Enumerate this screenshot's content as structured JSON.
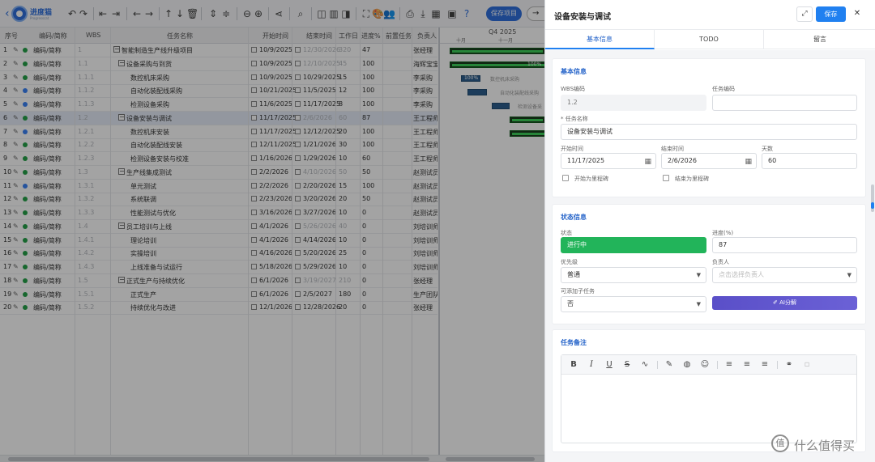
{
  "toolbar": {
    "logo_text": "进度猫",
    "logo_sub": "Progresscat",
    "save_project_label": "保存项目"
  },
  "grid": {
    "columns": [
      "序号",
      "编码/简称",
      "WBS",
      "任务名称",
      "开始时间",
      "结束时间",
      "工作日",
      "进度%",
      "前置任务",
      "负责人"
    ],
    "rows": [
      {
        "no": "1",
        "code": "编码/简称",
        "wbs": "1",
        "name": "智能制造生产线升级项目",
        "start": "10/9/2025",
        "end": "12/30/2026",
        "days": "320",
        "pct": "47",
        "owner": "张经理",
        "level": 0,
        "group": true
      },
      {
        "no": "2",
        "code": "编码/简称",
        "wbs": "1.1",
        "name": "设备采购与到货",
        "start": "10/9/2025",
        "end": "12/10/2025",
        "days": "45",
        "pct": "100",
        "owner": "海辉宝宝",
        "level": 1,
        "group": true
      },
      {
        "no": "3",
        "code": "编码/简称",
        "wbs": "1.1.1",
        "name": "数控机床采购",
        "start": "10/9/2025",
        "end": "10/29/2025",
        "days": "15",
        "pct": "100",
        "owner": "李采购",
        "level": 2,
        "group": false
      },
      {
        "no": "4",
        "code": "编码/简称",
        "wbs": "1.1.2",
        "name": "自动化装配线采购",
        "start": "10/21/2025",
        "end": "11/5/2025",
        "days": "12",
        "pct": "100",
        "owner": "李采购",
        "level": 2,
        "group": false
      },
      {
        "no": "5",
        "code": "编码/简称",
        "wbs": "1.1.3",
        "name": "检测设备采购",
        "start": "11/6/2025",
        "end": "11/17/2025",
        "days": "8",
        "pct": "100",
        "owner": "李采购",
        "level": 2,
        "group": false
      },
      {
        "no": "6",
        "code": "编码/简称",
        "wbs": "1.2",
        "name": "设备安装与调试",
        "start": "11/17/2025",
        "end": "2/6/2026",
        "days": "60",
        "pct": "87",
        "owner": "王工程师",
        "level": 1,
        "group": true
      },
      {
        "no": "7",
        "code": "编码/简称",
        "wbs": "1.2.1",
        "name": "数控机床安装",
        "start": "11/17/2025",
        "end": "12/12/2025",
        "days": "20",
        "pct": "100",
        "owner": "王工程师",
        "level": 2,
        "group": false
      },
      {
        "no": "8",
        "code": "编码/简称",
        "wbs": "1.2.2",
        "name": "自动化装配线安装",
        "start": "12/11/2025",
        "end": "1/21/2026",
        "days": "30",
        "pct": "100",
        "owner": "王工程师",
        "level": 2,
        "group": false
      },
      {
        "no": "9",
        "code": "编码/简称",
        "wbs": "1.2.3",
        "name": "检测设备安装与校准",
        "start": "1/16/2026",
        "end": "1/29/2026",
        "days": "10",
        "pct": "60",
        "owner": "王工程师",
        "level": 2,
        "group": false
      },
      {
        "no": "10",
        "code": "编码/简称",
        "wbs": "1.3",
        "name": "生产线集成测试",
        "start": "2/2/2026",
        "end": "4/10/2026",
        "days": "50",
        "pct": "50",
        "owner": "赵测试员",
        "level": 1,
        "group": true
      },
      {
        "no": "11",
        "code": "编码/简称",
        "wbs": "1.3.1",
        "name": "单元测试",
        "start": "2/2/2026",
        "end": "2/20/2026",
        "days": "15",
        "pct": "100",
        "owner": "赵测试员",
        "level": 2,
        "group": false
      },
      {
        "no": "12",
        "code": "编码/简称",
        "wbs": "1.3.2",
        "name": "系统联调",
        "start": "2/23/2026",
        "end": "3/20/2026",
        "days": "20",
        "pct": "50",
        "owner": "赵测试员",
        "level": 2,
        "group": false
      },
      {
        "no": "13",
        "code": "编码/简称",
        "wbs": "1.3.3",
        "name": "性能测试与优化",
        "start": "3/16/2026",
        "end": "3/27/2026",
        "days": "10",
        "pct": "0",
        "owner": "赵测试员",
        "level": 2,
        "group": false
      },
      {
        "no": "14",
        "code": "编码/简称",
        "wbs": "1.4",
        "name": "员工培训与上线",
        "start": "4/1/2026",
        "end": "5/26/2026",
        "days": "40",
        "pct": "0",
        "owner": "刘培训师",
        "level": 1,
        "group": true
      },
      {
        "no": "15",
        "code": "编码/简称",
        "wbs": "1.4.1",
        "name": "理论培训",
        "start": "4/1/2026",
        "end": "4/14/2026",
        "days": "10",
        "pct": "0",
        "owner": "刘培训师",
        "level": 2,
        "group": false
      },
      {
        "no": "16",
        "code": "编码/简称",
        "wbs": "1.4.2",
        "name": "实操培训",
        "start": "4/16/2026",
        "end": "5/20/2026",
        "days": "25",
        "pct": "0",
        "owner": "刘培训师",
        "level": 2,
        "group": false
      },
      {
        "no": "17",
        "code": "编码/简称",
        "wbs": "1.4.3",
        "name": "上线准备与试运行",
        "start": "5/18/2026",
        "end": "5/29/2026",
        "days": "10",
        "pct": "0",
        "owner": "刘培训师",
        "level": 2,
        "group": false
      },
      {
        "no": "18",
        "code": "编码/简称",
        "wbs": "1.5",
        "name": "正式生产与持续优化",
        "start": "6/1/2026",
        "end": "3/19/2027",
        "days": "210",
        "pct": "0",
        "owner": "张经理",
        "level": 1,
        "group": true
      },
      {
        "no": "19",
        "code": "编码/简称",
        "wbs": "1.5.1",
        "name": "正式生产",
        "start": "6/1/2026",
        "end": "2/5/2027",
        "days": "180",
        "pct": "0",
        "owner": "生产团队",
        "level": 2,
        "group": false
      },
      {
        "no": "20",
        "code": "编码/简称",
        "wbs": "1.5.2",
        "name": "持续优化与改进",
        "start": "12/1/2026",
        "end": "12/28/2026",
        "days": "20",
        "pct": "0",
        "owner": "张经理",
        "level": 2,
        "group": false
      }
    ]
  },
  "gantt": {
    "quarter": "Q4 2025",
    "months": [
      "十月",
      "十一月"
    ],
    "bar_pct_label": "100%",
    "bar_labels": [
      "数控机床采购",
      "自动化装配线采购",
      "检测设备采"
    ]
  },
  "panel": {
    "title": "设备安装与调试",
    "save_label": "保存",
    "tabs": [
      "基本信息",
      "TODO",
      "留言"
    ],
    "basic": {
      "title": "基本信息",
      "wbs_label": "WBS编码",
      "wbs_value": "1.2",
      "code_label": "任务编码",
      "code_value": "",
      "name_label": "* 任务名称",
      "name_value": "设备安装与调试",
      "start_label": "开始时间",
      "start_value": "11/17/2025",
      "end_label": "结束时间",
      "end_value": "2/6/2026",
      "days_label": "天数",
      "days_value": "60",
      "start_milestone": "开始为里程碑",
      "end_milestone": "结束为里程碑"
    },
    "status": {
      "title": "状态信息",
      "status_label": "状态",
      "status_value": "进行中",
      "progress_label": "进度(%)",
      "progress_value": "87",
      "priority_label": "优先级",
      "priority_value": "普通",
      "owner_label": "负责人",
      "owner_placeholder": "点击选择负责人",
      "subtask_label": "可添加子任务",
      "subtask_value": "否",
      "ai_label": "AI分解"
    },
    "notes": {
      "title": "任务备注"
    }
  },
  "watermark": "什么值得买",
  "colors": {
    "primary": "#2080f0",
    "status_green": "#22b45a",
    "ai_purple": "#5a4fc8",
    "gantt_bar": "#1b3d1f",
    "gantt_progress": "#3dd15a"
  }
}
